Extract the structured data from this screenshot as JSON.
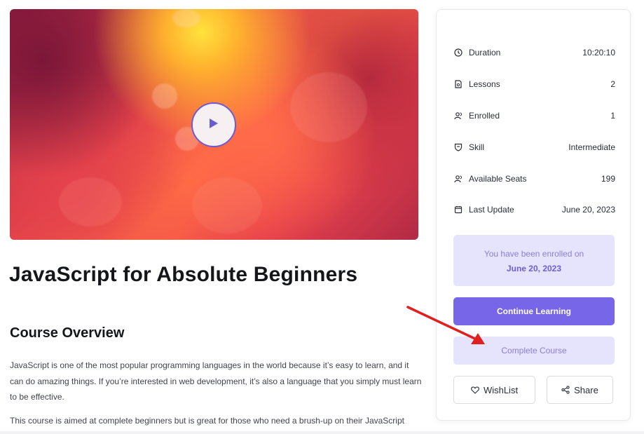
{
  "course": {
    "title": "JavaScript for Absolute Beginners",
    "overview_heading": "Course Overview",
    "paragraphs": [
      "JavaScript is one of the most popular programming languages in the world because it’s easy to learn, and it can do amazing things. If you’re interested in web development, it’s also a language that you simply must learn to be effective.",
      "This course is aimed at complete beginners but is great for those who need a brush-up on their JavaScript skills."
    ]
  },
  "video": {
    "play_icon": "play-icon"
  },
  "sidebar": {
    "info": [
      {
        "icon": "clock-icon",
        "label": "Duration",
        "value": "10:20:10"
      },
      {
        "icon": "lessons-icon",
        "label": "Lessons",
        "value": "2"
      },
      {
        "icon": "users-icon",
        "label": "Enrolled",
        "value": "1"
      },
      {
        "icon": "shield-icon",
        "label": "Skill",
        "value": "Intermediate"
      },
      {
        "icon": "seats-icon",
        "label": "Available Seats",
        "value": "199"
      },
      {
        "icon": "calendar-icon",
        "label": "Last Update",
        "value": "June 20, 2023"
      }
    ],
    "enrolled_text": "You have been enrolled on",
    "enrolled_date": "June 20, 2023",
    "continue_label": "Continue Learning",
    "complete_label": "Complete Course",
    "wishlist_label": "WishList",
    "share_label": "Share"
  },
  "colors": {
    "accent": "#7766e8",
    "accent_light": "#e6e3fd",
    "annotation_arrow": "#e0201e"
  }
}
